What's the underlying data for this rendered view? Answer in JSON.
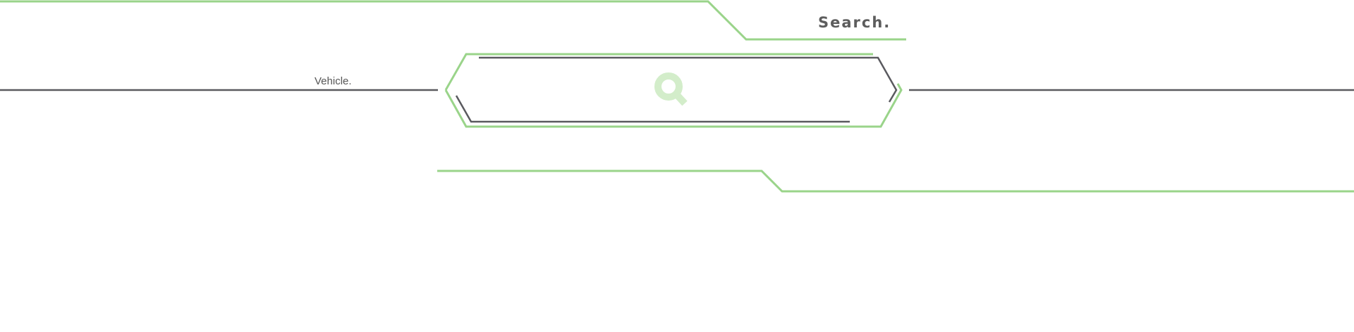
{
  "header": {
    "title": "Search."
  },
  "search": {
    "field_label": "Vehicle.",
    "input_value": "",
    "button_icon": "search-icon"
  },
  "colors": {
    "accent_green": "#9ad48a",
    "icon_green": "#d3edca",
    "line_gray": "#5a5a5f"
  }
}
